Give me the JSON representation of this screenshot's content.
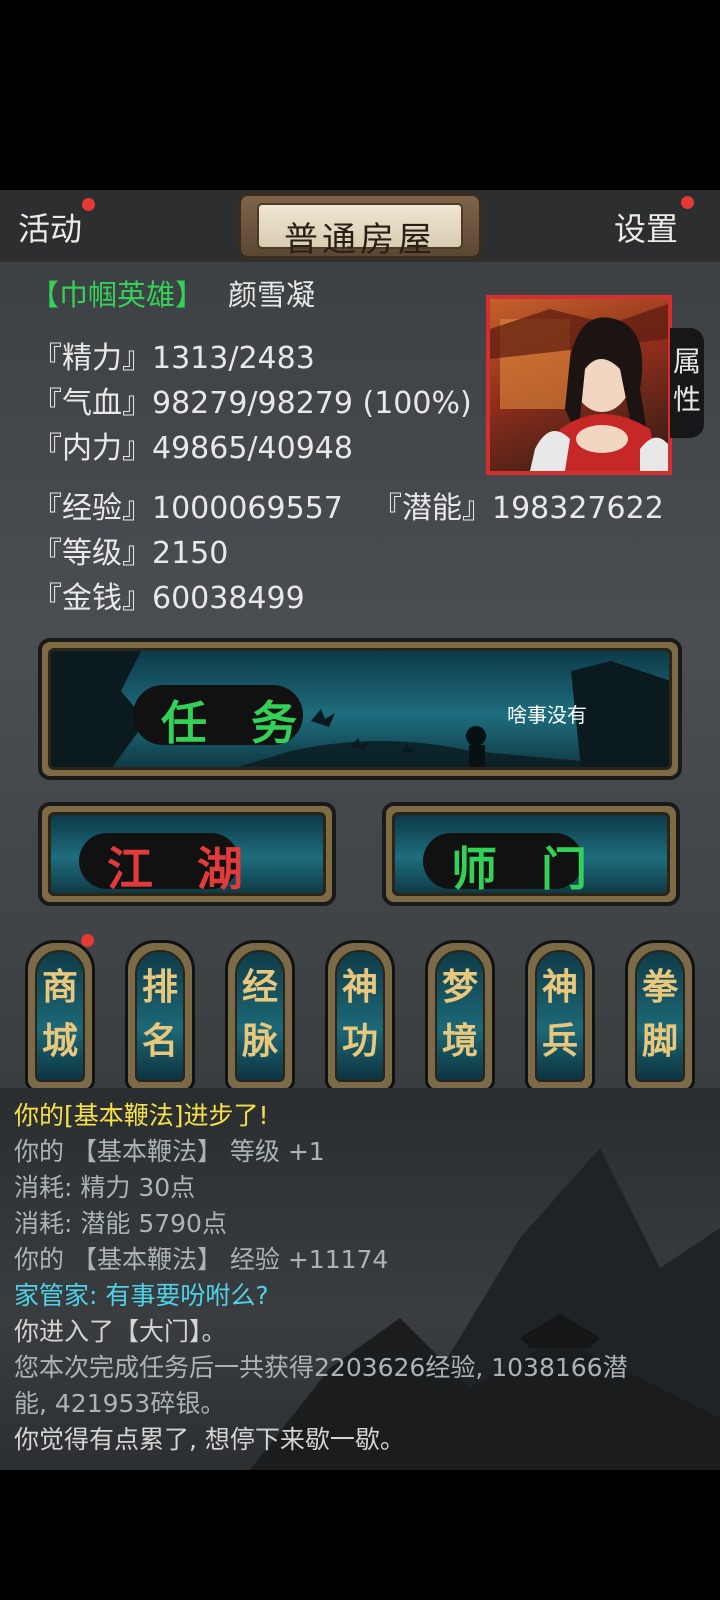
{
  "topbar": {
    "activity": "活动",
    "title": "普通房屋",
    "settings": "设置"
  },
  "profile": {
    "title_tag": "【巾帼英雄】",
    "name": "颜雪凝",
    "stamina": "『精力』1313/2483",
    "health": "『气血』98279/98279 (100%)",
    "inner_power": "『内力』49865/40948",
    "experience": "『经验』1000069557",
    "potential": "『潜能』198327622",
    "level": "『等级』2150",
    "money": "『金钱』60038499",
    "attributes_tab": "属性"
  },
  "quest": {
    "label": "任 务",
    "status": "啥事没有"
  },
  "big_buttons": {
    "jianghu": "江 湖",
    "shimen": "师 门"
  },
  "menu": [
    {
      "label": "商城"
    },
    {
      "label": "排名"
    },
    {
      "label": "经脉"
    },
    {
      "label": "神功"
    },
    {
      "label": "梦境"
    },
    {
      "label": "神兵"
    },
    {
      "label": "拳脚"
    }
  ],
  "log": [
    {
      "text": "你的[基本鞭法]进步了!",
      "color": "#f5e04a"
    },
    {
      "text": "你的 【基本鞭法】 等级 +1",
      "color": "#a9b4b9"
    },
    {
      "text": "消耗: 精力 30点",
      "color": "#a9b4b9"
    },
    {
      "text": "消耗: 潜能 5790点",
      "color": "#a9b4b9"
    },
    {
      "text": "你的 【基本鞭法】 经验 +11174",
      "color": "#a9b4b9"
    },
    {
      "text": "家管家: 有事要吩咐么?",
      "color": "#4fd1e8"
    },
    {
      "text": "你进入了【大门】。",
      "color": "#d4d4d4"
    },
    {
      "text": "您本次完成任务后一共获得2203626经验, 1038166潜",
      "color": "#a9b4b9"
    },
    {
      "text": "能, 421953碎银。",
      "color": "#a9b4b9"
    },
    {
      "text": "你觉得有点累了, 想停下来歇一歇。",
      "color": "#d4d4d4"
    }
  ],
  "colors": {
    "jianghu_label": "#e23b3b",
    "shimen_label": "#34d158",
    "quest_label": "#34d158",
    "notification_dot": "#e53935"
  }
}
